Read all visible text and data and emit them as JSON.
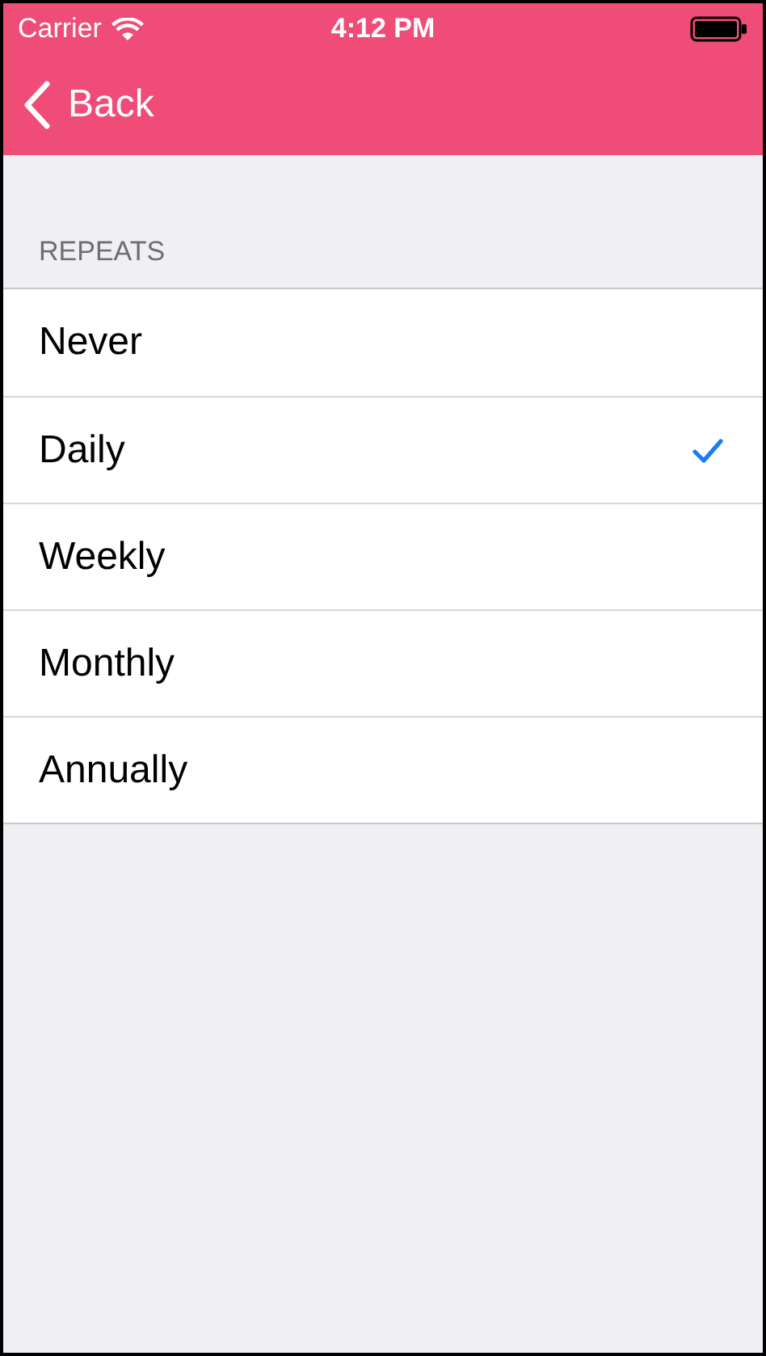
{
  "status_bar": {
    "carrier": "Carrier",
    "time": "4:12 PM"
  },
  "nav": {
    "back": "Back"
  },
  "section": {
    "header": "REPEATS",
    "options": [
      {
        "label": "Never",
        "selected": false
      },
      {
        "label": "Daily",
        "selected": true
      },
      {
        "label": "Weekly",
        "selected": false
      },
      {
        "label": "Monthly",
        "selected": false
      },
      {
        "label": "Annually",
        "selected": false
      }
    ]
  }
}
